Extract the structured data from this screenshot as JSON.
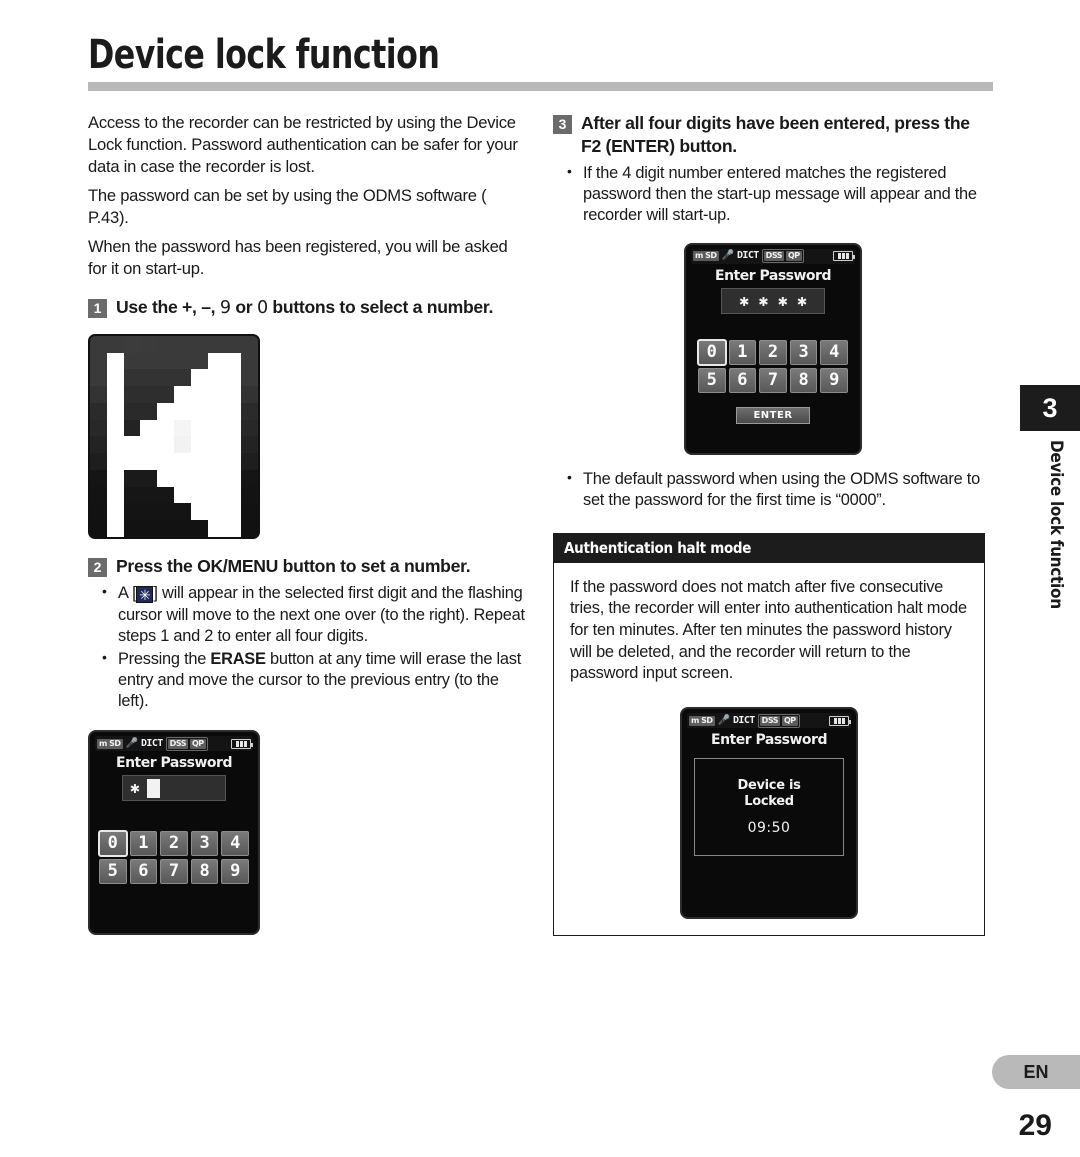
{
  "page": {
    "title": "Device lock function",
    "number": "29",
    "language_tab": "EN",
    "chapter_number": "3",
    "chapter_vertical_label": "Device lock function"
  },
  "left_column": {
    "intro_paragraphs": [
      "Access to the recorder can be restricted by using the Device Lock function. Password authentication can be safer for your data in case the recorder is lost.",
      "The password can be set by using the ODMS software (  P.43).",
      "When the password has been registered, you will be asked for it on start-up."
    ],
    "step1": {
      "number": "1",
      "text_parts": {
        "a": "Use the +, –, ",
        "symbol_9": "9",
        "b": " or ",
        "symbol_0": "0",
        "c": " buttons to select a number."
      },
      "full_text": "Use the +, –, 9 or 0 buttons to select a number."
    },
    "redacted_image_caption": "",
    "step2": {
      "number": "2",
      "text_bold": "Press the OK/MENU button to set a number.",
      "bullets": [
        {
          "pre": "A [",
          "icon": "✳",
          "post": "] will appear in the selected first digit and the flashing cursor will move to the next one over (to the right). Repeat steps 1 and 2 to enter all four digits."
        },
        {
          "pre": "Pressing the ",
          "bold": "ERASE",
          "post": " button at any time will erase the last entry and move the cursor to the previous entry (to the left)."
        }
      ]
    },
    "lcd_entry": {
      "status": {
        "memory": "m SD",
        "mic_icon": "mic-icon",
        "mode": "DICT",
        "format": "DSS",
        "quality": "QP",
        "battery": "battery-full-icon"
      },
      "title": "Enter Password",
      "entered": "✱",
      "cursor_visible": true,
      "keypad_rows": [
        [
          "0",
          "1",
          "2",
          "3",
          "4"
        ],
        [
          "5",
          "6",
          "7",
          "8",
          "9"
        ]
      ],
      "selected_key": "0",
      "enter_button": null
    }
  },
  "right_column": {
    "step3": {
      "number": "3",
      "text_bold": "After all four digits have been entered, press the F2 (ENTER) button.",
      "bullets": [
        "If the 4 digit number entered matches the registered password then the start-up message will appear and the recorder will start-up."
      ]
    },
    "lcd_filled": {
      "status": {
        "memory": "m SD",
        "mic_icon": "mic-icon",
        "mode": "DICT",
        "format": "DSS",
        "quality": "QP",
        "battery": "battery-full-icon"
      },
      "title": "Enter Password",
      "entered": "✱ ✱ ✱ ✱",
      "keypad_rows": [
        [
          "0",
          "1",
          "2",
          "3",
          "4"
        ],
        [
          "5",
          "6",
          "7",
          "8",
          "9"
        ]
      ],
      "selected_key": "0",
      "enter_button": "ENTER"
    },
    "bullets_after": [
      "The default password when using the ODMS software to set the password for the first time is “0000”."
    ],
    "note_box": {
      "heading": "Authentication halt mode",
      "body": "If the password does not match after five consecutive tries, the recorder will enter into authentication halt mode for ten minutes. After ten minutes the password history will be deleted, and the recorder will return to the password input screen."
    },
    "lcd_locked": {
      "status": {
        "memory": "m SD",
        "mic_icon": "mic-icon",
        "mode": "DICT",
        "format": "DSS",
        "quality": "QP",
        "battery": "battery-full-icon"
      },
      "title": "Enter Password",
      "message_line1": "Device is",
      "message_line2": "Locked",
      "timer": "09:50"
    }
  },
  "colors": {
    "title_rule": "#b9b9b9",
    "step_badge": "#6b6b6b",
    "note_header": "#1c1c1c",
    "lang_tab": "#b9b9b9",
    "chapter_tab": "#1c1c1c"
  }
}
